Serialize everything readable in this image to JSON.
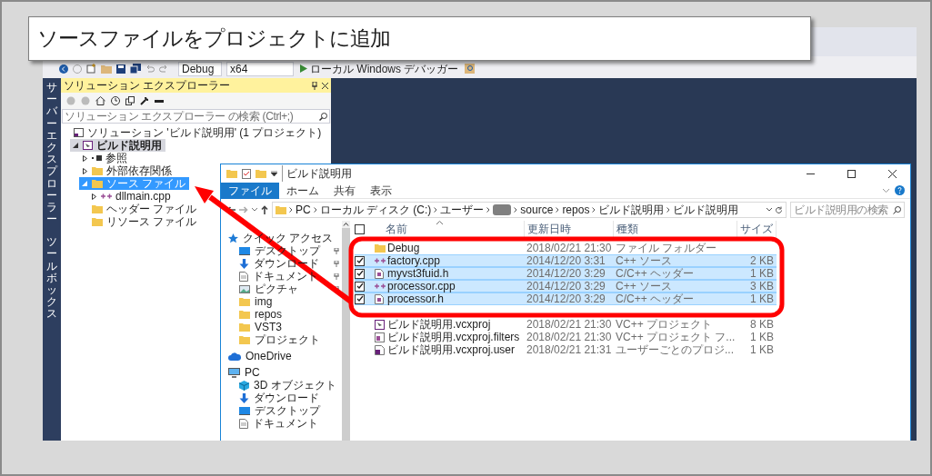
{
  "caption": "ソースファイルをプロジェクトに追加",
  "toolbar": {
    "configuration": "Debug",
    "platform": "x64",
    "run_label": "ローカル Windows デバッガー"
  },
  "side_tabs": [
    "サーバーエクスプローラー",
    "ツールボックス"
  ],
  "solution_explorer": {
    "title": "ソリューション エクスプローラー",
    "search_placeholder": "ソリューション エクスプローラー の検索 (Ctrl+;)",
    "tree": [
      {
        "label": "ソリューション 'ビルド説明用' (1 プロジェクト)",
        "kind": "solution",
        "selected": false,
        "children": [
          {
            "label": "ビルド説明用",
            "kind": "project",
            "expanded": true,
            "selected": false,
            "children": [
              {
                "label": "参照",
                "kind": "references",
                "expanded": false,
                "selected": false
              },
              {
                "label": "外部依存関係",
                "kind": "folder",
                "expanded": false,
                "selected": false
              },
              {
                "label": "ソース ファイル",
                "kind": "folder",
                "expanded": true,
                "selected": true,
                "children": [
                  {
                    "label": "dllmain.cpp",
                    "kind": "cpp",
                    "expanded": false,
                    "selected": false
                  }
                ]
              },
              {
                "label": "ヘッダー ファイル",
                "kind": "folder",
                "selected": false
              },
              {
                "label": "リソース ファイル",
                "kind": "folder",
                "selected": false
              }
            ]
          }
        ]
      }
    ]
  },
  "file_explorer": {
    "title": "ビルド説明用",
    "ribbon_tabs": [
      {
        "label": "ファイル",
        "selected": true
      },
      {
        "label": "ホーム",
        "selected": false
      },
      {
        "label": "共有",
        "selected": false
      },
      {
        "label": "表示",
        "selected": false
      }
    ],
    "breadcrumb": [
      {
        "kind": "text",
        "label": "PC"
      },
      {
        "kind": "text",
        "label": "ローカル ディスク (C:)"
      },
      {
        "kind": "text",
        "label": "ユーザー"
      },
      {
        "kind": "redacted"
      },
      {
        "kind": "text",
        "label": "source"
      },
      {
        "kind": "text",
        "label": "repos"
      },
      {
        "kind": "text",
        "label": "ビルド説明用"
      },
      {
        "kind": "text",
        "label": "ビルド説明用"
      }
    ],
    "search_placeholder": "ビルド説明用の検索",
    "nav": [
      {
        "label": "クイック アクセス",
        "kind": "star",
        "children": [
          {
            "label": "デスクトップ",
            "kind": "desktop",
            "pinned": true
          },
          {
            "label": "ダウンロード",
            "kind": "download",
            "pinned": true
          },
          {
            "label": "ドキュメント",
            "kind": "document",
            "pinned": true
          },
          {
            "label": "ピクチャ",
            "kind": "picture",
            "pinned": true
          },
          {
            "label": "img",
            "kind": "folder",
            "pinned": false
          },
          {
            "label": "repos",
            "kind": "folder",
            "pinned": false
          },
          {
            "label": "VST3",
            "kind": "folder",
            "pinned": false
          },
          {
            "label": "プロジェクト",
            "kind": "folder",
            "pinned": false
          }
        ]
      },
      {
        "label": "OneDrive",
        "kind": "cloud"
      },
      {
        "label": "PC",
        "kind": "pc",
        "children": [
          {
            "label": "3D オブジェクト",
            "kind": "cube"
          },
          {
            "label": "ダウンロード",
            "kind": "download"
          },
          {
            "label": "デスクトップ",
            "kind": "desktop"
          },
          {
            "label": "ドキュメント",
            "kind": "document"
          }
        ]
      }
    ],
    "columns": [
      "名前",
      "更新日時",
      "種類",
      "サイズ"
    ],
    "select_all": false,
    "files": [
      {
        "name": "Debug",
        "kind": "folder",
        "date": "2018/02/21 21:30",
        "type": "ファイル フォルダー",
        "selected": false
      },
      {
        "name": "factory.cpp",
        "kind": "cpp",
        "date": "2014/12/20 3:31",
        "type": "C++ ソース",
        "size": "2 KB",
        "selected": true
      },
      {
        "name": "myvst3fuid.h",
        "kind": "header",
        "date": "2014/12/20 3:29",
        "type": "C/C++ ヘッダー",
        "size": "1 KB",
        "selected": true
      },
      {
        "name": "processor.cpp",
        "kind": "cpp",
        "date": "2014/12/20 3:29",
        "type": "C++ ソース",
        "size": "3 KB",
        "selected": true
      },
      {
        "name": "processor.h",
        "kind": "header",
        "date": "2014/12/20 3:29",
        "type": "C/C++ ヘッダー",
        "size": "1 KB",
        "selected": true
      },
      {
        "kind": "hidden"
      },
      {
        "name": "ビルド説明用.vcxproj",
        "kind": "vcxproj",
        "date": "2018/02/21 21:30",
        "type": "VC++ プロジェクト",
        "size": "8 KB",
        "selected": false
      },
      {
        "name": "ビルド説明用.vcxproj.filters",
        "kind": "filters",
        "date": "2018/02/21 21:30",
        "type": "VC++ プロジェクト フ...",
        "size": "1 KB",
        "selected": false
      },
      {
        "name": "ビルド説明用.vcxproj.user",
        "kind": "user",
        "date": "2018/02/21 21:31",
        "type": "ユーザーごとのプロジ...",
        "size": "1 KB",
        "selected": false
      }
    ]
  }
}
